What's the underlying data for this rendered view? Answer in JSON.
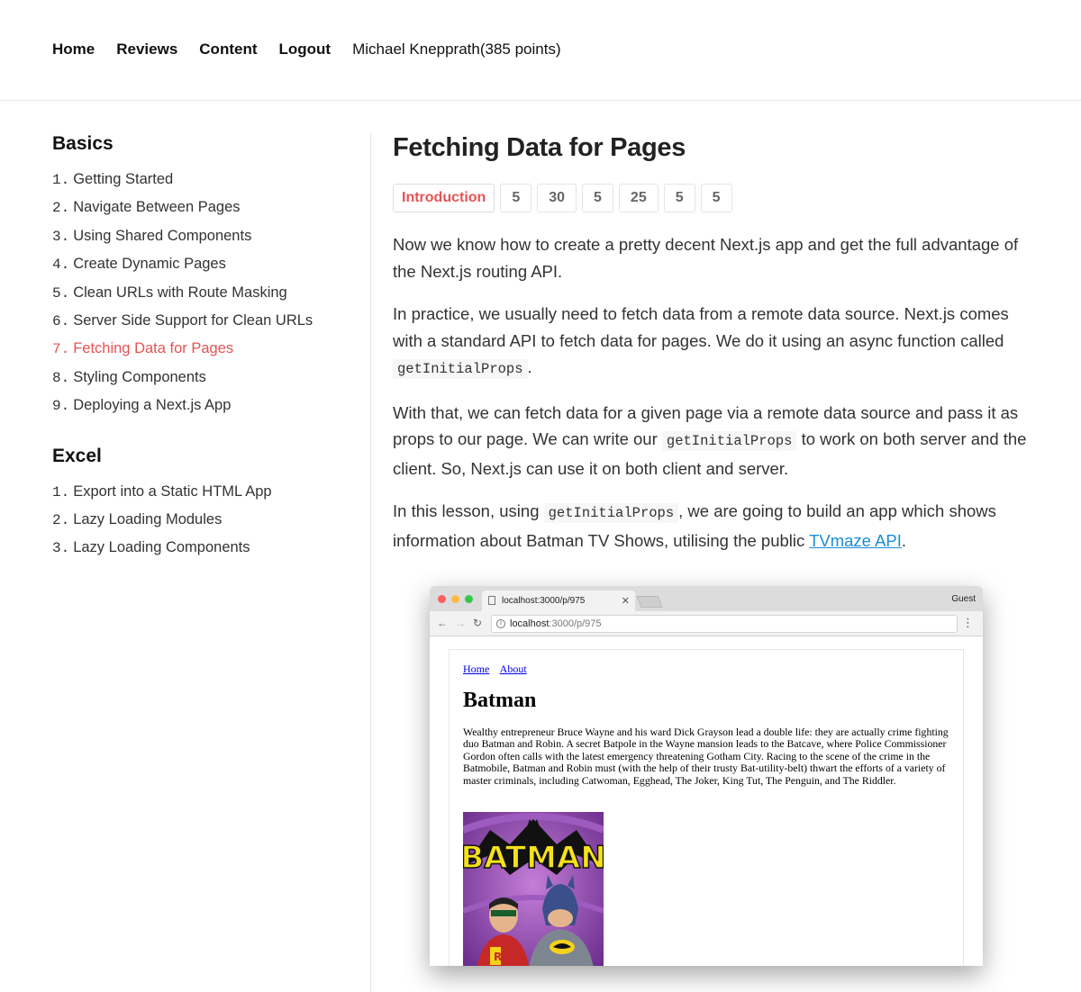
{
  "topnav": {
    "links": [
      "Home",
      "Reviews",
      "Content",
      "Logout"
    ],
    "user": "Michael Knepprath(385 points)"
  },
  "sidebar": {
    "sections": [
      {
        "title": "Basics",
        "items": [
          {
            "num": "1.",
            "label": "Getting Started"
          },
          {
            "num": "2.",
            "label": "Navigate Between Pages"
          },
          {
            "num": "3.",
            "label": "Using Shared Components"
          },
          {
            "num": "4.",
            "label": "Create Dynamic Pages"
          },
          {
            "num": "5.",
            "label": "Clean URLs with Route Masking"
          },
          {
            "num": "6.",
            "label": "Server Side Support for Clean URLs"
          },
          {
            "num": "7.",
            "label": "Fetching Data for Pages",
            "active": true
          },
          {
            "num": "8.",
            "label": "Styling Components"
          },
          {
            "num": "9.",
            "label": "Deploying a Next.js App"
          }
        ]
      },
      {
        "title": "Excel",
        "items": [
          {
            "num": "1.",
            "label": "Export into a Static HTML App"
          },
          {
            "num": "2.",
            "label": "Lazy Loading Modules"
          },
          {
            "num": "3.",
            "label": "Lazy Loading Components"
          }
        ]
      }
    ]
  },
  "main": {
    "title": "Fetching Data for Pages",
    "steps": [
      "Introduction",
      "5",
      "30",
      "5",
      "25",
      "5",
      "5"
    ],
    "p1": "Now we know how to create a pretty decent Next.js app and get the full advantage of the Next.js routing API.",
    "p2_a": "In practice, we usually need to fetch data from a remote data source. Next.js comes with a standard API to fetch data for pages. We do it using an async function called",
    "p2_code": "getInitialProps",
    "p2_b": ".",
    "p3_a": "With that, we can fetch data for a given page via a remote data source and pass it as props to our page. We can write our",
    "p3_code": "getInitialProps",
    "p3_b": "to work on both server and the client. So, Next.js can use it on both client and server.",
    "p4_a": "In this lesson, using",
    "p4_code": "getInitialProps",
    "p4_b": ", we are going to build an app which shows information about Batman TV Shows, utilising the public",
    "p4_link": "TVmaze API",
    "p4_c": "."
  },
  "screenshot": {
    "tab_title": "localhost:3000/p/975",
    "profile": "Guest",
    "url_host": "localhost",
    "url_path": ":3000/p/975",
    "nav_links": [
      "Home",
      "About"
    ],
    "heading": "Batman",
    "summary": "Wealthy entrepreneur Bruce Wayne and his ward Dick Grayson lead a double life: they are actually crime fighting duo Batman and Robin. A secret Batpole in the Wayne mansion leads to the Batcave, where Police Commissioner Gordon often calls with the latest emergency threatening Gotham City. Racing to the scene of the crime in the Batmobile, Batman and Robin must (with the help of their trusty Bat-utility-belt) thwart the efforts of a variety of master criminals, including Catwoman, Egghead, The Joker, King Tut, The Penguin, and The Riddler.",
    "poster_text": "BATMAN"
  },
  "colors": {
    "accent": "#e55353",
    "link": "#1a8cd8"
  }
}
